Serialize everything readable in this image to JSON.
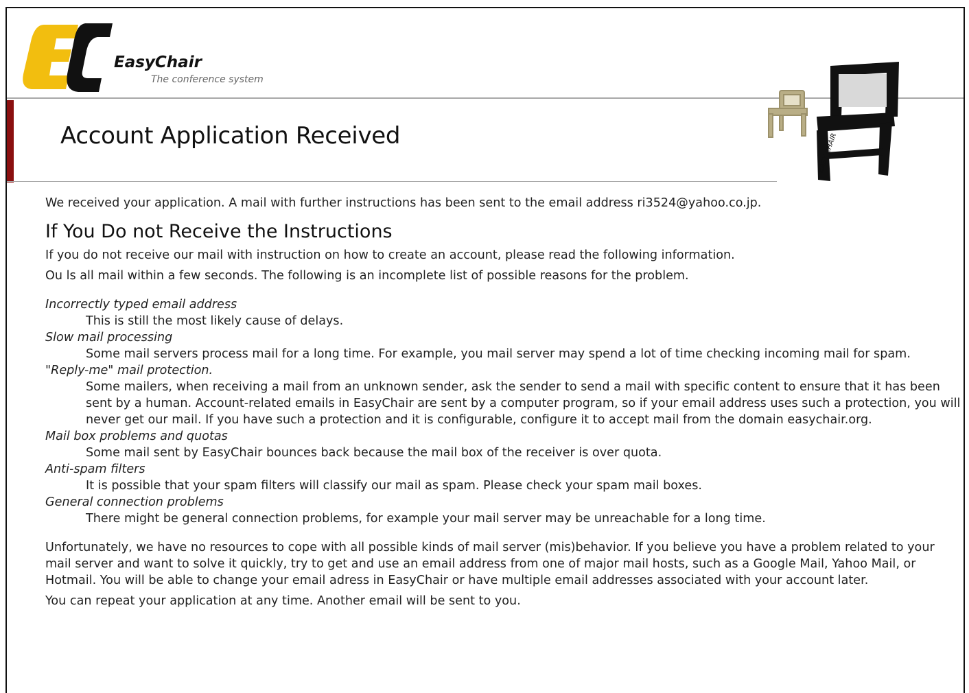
{
  "header": {
    "brand_name": "EasyChair",
    "brand_tagline": "The conference system",
    "logo_letters": "EC",
    "chair_caption": "EASY CHAIR"
  },
  "page_title": "Account Application Received",
  "intro": "We received your application. A mail with further instructions has been sent to the email address ri3524@yahoo.co.jp.",
  "section_title": "If You Do not Receive the Instructions",
  "section_intro": "If you do not receive our mail with instruction on how to create an account, please read the following information.",
  "obscured_paragraph": "Ou                                                              ls all mail within a few seconds. The following is an incomplete list of possible reasons for the problem.",
  "reasons": [
    {
      "term": "Incorrectly typed email address",
      "desc": "This is still the most likely cause of delays."
    },
    {
      "term": "Slow mail processing",
      "desc": "Some mail servers process mail for a long time. For example, you mail server may spend a lot of time checking incoming mail for spam."
    },
    {
      "term": "\"Reply-me\" mail protection.",
      "desc": "Some mailers, when receiving a mail from an unknown sender, ask the sender to send a mail with specific content to ensure that it has been sent by a human. Account-related emails in EasyChair are sent by a computer program, so if your email address uses such a protection, you will never get our mail. If you have such a protection and it is configurable, configure it to accept mail from the domain easychair.org."
    },
    {
      "term": "Mail box problems and quotas",
      "desc": "Some mail sent by EasyChair bounces back because the mail box of the receiver is over quota."
    },
    {
      "term": "Anti-spam filters",
      "desc": "It is possible that your spam filters will classify our mail as spam. Please check your spam mail boxes."
    },
    {
      "term": "General connection problems",
      "desc": "There might be general connection problems, for example your mail server may be unreachable for a long time."
    }
  ],
  "outro": "Unfortunately, we have no resources to cope with all possible kinds of mail server (mis)behavior. If you believe you have a problem related to your mail server and want to solve it quickly, try to get and use an email address from one of major mail hosts, such as a Google Mail, Yahoo Mail, or Hotmail. You will be able to change your email adress in EasyChair or have multiple email addresses associated with your account later.",
  "repeat": "You can repeat your application at any time. Another email will be sent to you.",
  "colors": {
    "logo_yellow": "#f2be0f",
    "logo_black": "#111111",
    "accent_red": "#8a0f0f",
    "divider_gray": "#a8a8a8"
  }
}
